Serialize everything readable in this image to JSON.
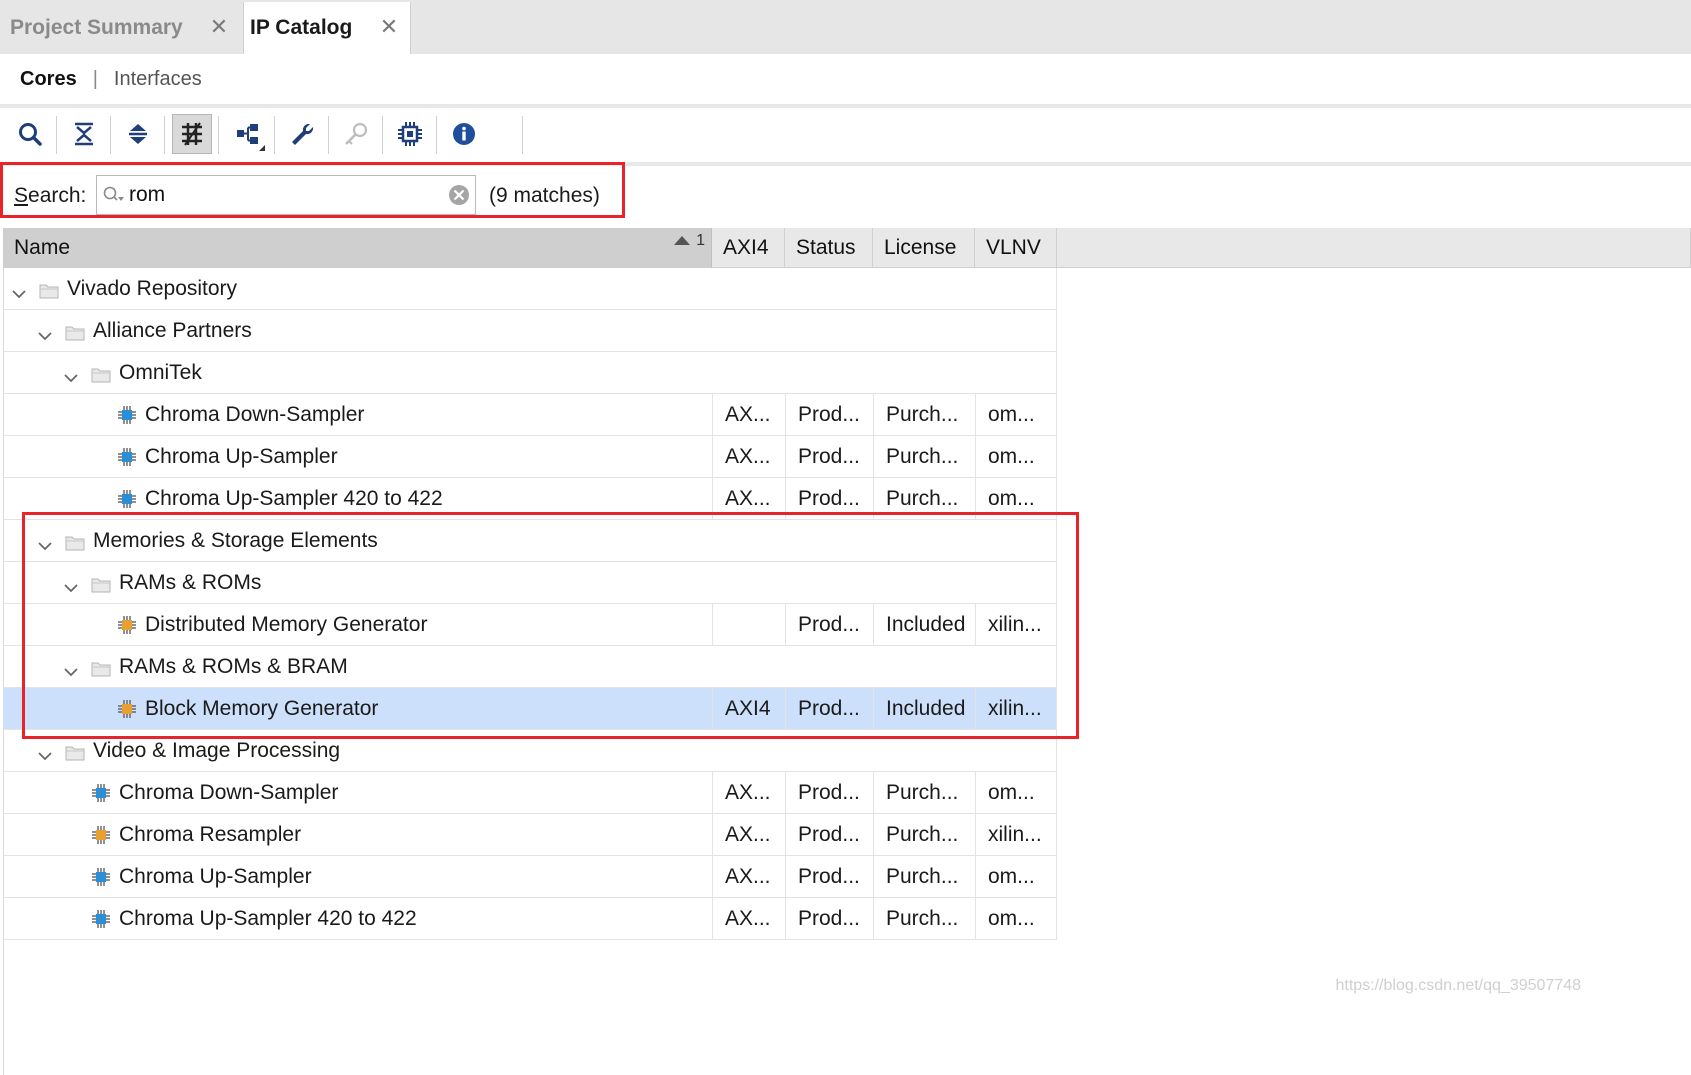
{
  "tabs": [
    {
      "label": "Project Summary",
      "active": false
    },
    {
      "label": "IP Catalog",
      "active": true
    }
  ],
  "subtabs": {
    "cores": "Cores",
    "separator": "|",
    "interfaces": "Interfaces"
  },
  "toolbar": {
    "buttons": [
      {
        "icon": "search-icon",
        "pressed": false
      },
      {
        "icon": "collapse-all-icon",
        "pressed": false
      },
      {
        "icon": "expand-all-icon",
        "pressed": false
      },
      {
        "icon": "filter-icon",
        "pressed": true
      },
      {
        "icon": "hierarchy-icon",
        "pressed": false,
        "has_menu": true
      },
      {
        "icon": "wrench-icon",
        "pressed": false
      },
      {
        "icon": "key-icon",
        "pressed": false,
        "disabled": true
      },
      {
        "icon": "chip-icon",
        "pressed": false
      },
      {
        "icon": "info-icon",
        "pressed": false
      }
    ]
  },
  "search": {
    "label_prefix": "",
    "label_mnemonic": "S",
    "label_rest": "earch:",
    "value": "rom",
    "matches": "(9 matches)"
  },
  "columns": {
    "name": "Name",
    "sort_index": "1",
    "axi4": "AXI4",
    "status": "Status",
    "license": "License",
    "vlnv": "VLNV"
  },
  "rows": [
    {
      "kind": "folder",
      "level": 0,
      "name": "Vivado Repository",
      "expanded": true
    },
    {
      "kind": "folder",
      "level": 1,
      "name": "Alliance Partners",
      "expanded": true
    },
    {
      "kind": "folder",
      "level": 2,
      "name": "OmniTek",
      "expanded": true
    },
    {
      "kind": "ip",
      "level": 3,
      "name": "Chroma Down-Sampler",
      "ip_color": "blue",
      "axi4": "AX...",
      "status": "Prod...",
      "license": "Purch...",
      "vlnv": "om..."
    },
    {
      "kind": "ip",
      "level": 3,
      "name": "Chroma Up-Sampler",
      "ip_color": "blue",
      "axi4": "AX...",
      "status": "Prod...",
      "license": "Purch...",
      "vlnv": "om..."
    },
    {
      "kind": "ip",
      "level": 3,
      "name": "Chroma Up-Sampler 420 to 422",
      "ip_color": "blue",
      "axi4": "AX...",
      "status": "Prod...",
      "license": "Purch...",
      "vlnv": "om..."
    },
    {
      "kind": "folder",
      "level": 1,
      "name": "Memories & Storage Elements",
      "expanded": true
    },
    {
      "kind": "folder",
      "level": 2,
      "name": "RAMs & ROMs",
      "expanded": true
    },
    {
      "kind": "ip",
      "level": 3,
      "name": "Distributed Memory Generator",
      "ip_color": "orange",
      "axi4": "",
      "status": "Prod...",
      "license": "Included",
      "vlnv": "xilin..."
    },
    {
      "kind": "folder",
      "level": 2,
      "name": "RAMs & ROMs & BRAM",
      "expanded": true
    },
    {
      "kind": "ip",
      "level": 3,
      "name": "Block Memory Generator",
      "ip_color": "orange",
      "axi4": "AXI4",
      "status": "Prod...",
      "license": "Included",
      "vlnv": "xilin...",
      "selected": true
    },
    {
      "kind": "folder",
      "level": 1,
      "name": "Video & Image Processing",
      "expanded": true
    },
    {
      "kind": "ip",
      "level": 2,
      "name": "Chroma Down-Sampler",
      "ip_color": "blue",
      "axi4": "AX...",
      "status": "Prod...",
      "license": "Purch...",
      "vlnv": "om..."
    },
    {
      "kind": "ip",
      "level": 2,
      "name": "Chroma Resampler",
      "ip_color": "orange",
      "axi4": "AX...",
      "status": "Prod...",
      "license": "Purch...",
      "vlnv": "xilin..."
    },
    {
      "kind": "ip",
      "level": 2,
      "name": "Chroma Up-Sampler",
      "ip_color": "blue",
      "axi4": "AX...",
      "status": "Prod...",
      "license": "Purch...",
      "vlnv": "om..."
    },
    {
      "kind": "ip",
      "level": 2,
      "name": "Chroma Up-Sampler 420 to 422",
      "ip_color": "blue",
      "axi4": "AX...",
      "status": "Prod...",
      "license": "Purch...",
      "vlnv": "om..."
    }
  ],
  "colors": {
    "selection": "#cde0fb",
    "annotation": "#e8232a",
    "ip_blue": "#2a8fd6",
    "ip_orange": "#e8a030",
    "info_blue": "#1f4e9c"
  },
  "watermark": "https://blog.csdn.net/qq_39507748"
}
